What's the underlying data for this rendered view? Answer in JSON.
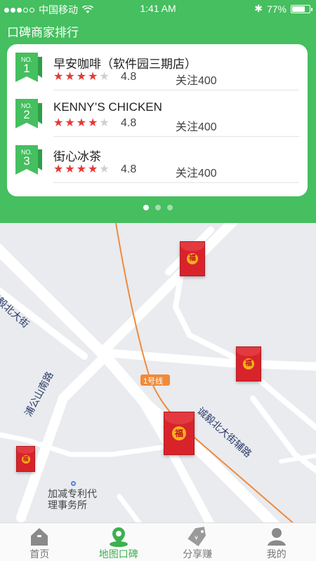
{
  "status_bar": {
    "carrier": "中国移动",
    "time": "1:41 AM",
    "battery": "77%",
    "battery_level": 0.77
  },
  "header": {
    "title": "口碑商家排行"
  },
  "ranking": [
    {
      "no_label": "NO.",
      "rank": "1",
      "name": "早安咖啡（软件园三期店）",
      "stars": 4,
      "rating": "4.8",
      "followers": "关注400"
    },
    {
      "no_label": "NO.",
      "rank": "2",
      "name": "KENNY’S CHICKEN",
      "stars": 4,
      "rating": "4.8",
      "followers": "关注400"
    },
    {
      "no_label": "NO.",
      "rank": "3",
      "name": "街心冰茶",
      "stars": 4,
      "rating": "4.8",
      "followers": "关注400"
    }
  ],
  "pager": {
    "count": 3,
    "active": 0
  },
  "map": {
    "roads": [
      "诚毅北大街",
      "浦公山南路",
      "诚毅北大街辅路"
    ],
    "metro_label": "1号线",
    "poi": [
      "加减专利代",
      "理事务所"
    ],
    "red_packet_glyph": "福"
  },
  "tabs": [
    {
      "label": "首页",
      "icon": "home-icon",
      "active": false
    },
    {
      "label": "地图口碑",
      "icon": "map-pin-icon",
      "active": true
    },
    {
      "label": "分享赚",
      "icon": "price-tag-icon",
      "active": false
    },
    {
      "label": "我的",
      "icon": "user-icon",
      "active": false
    }
  ],
  "colors": {
    "brand_green": "#45bf5f",
    "star_red": "#e53935",
    "red_packet": "#d9232b",
    "metro_orange": "#f08a3a"
  }
}
